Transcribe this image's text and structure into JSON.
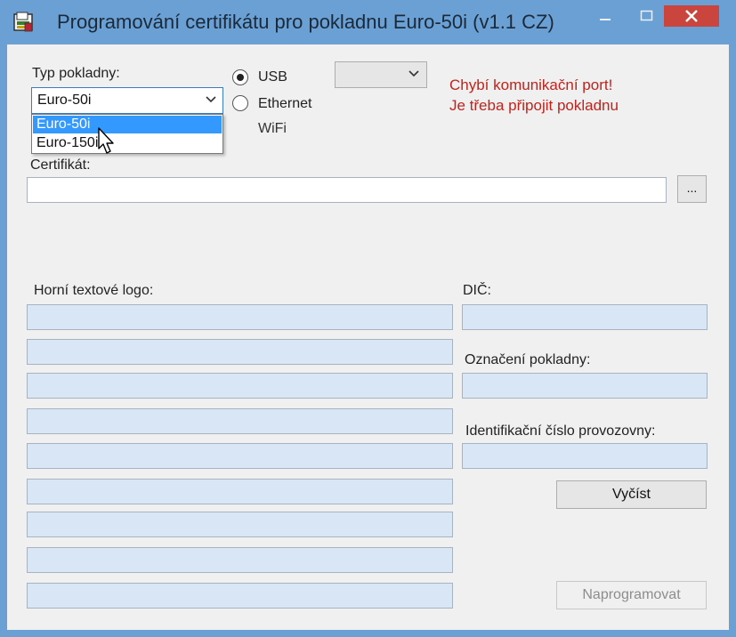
{
  "window": {
    "title": "Programování certifikátu pro pokladnu Euro-50i (v1.1 CZ)",
    "controls": {
      "minimize": "—",
      "maximize": "☐",
      "close": "✕"
    }
  },
  "cash_register_type": {
    "label": "Typ pokladny:",
    "selected": "Euro-50i",
    "options": [
      "Euro-50i",
      "Euro-150i"
    ]
  },
  "connection": {
    "options": [
      {
        "label": "USB",
        "checked": true
      },
      {
        "label": "Ethernet",
        "checked": false
      },
      {
        "label": "WiFi",
        "checked": false
      }
    ]
  },
  "error_message": {
    "line1": "Chybí komunikační port!",
    "line2": "Je třeba připojit pokladnu"
  },
  "certificate": {
    "label": "Certifikát:",
    "value": "",
    "browse_label": "..."
  },
  "upper_logo": {
    "label": "Horní textové logo:",
    "lines": [
      "",
      "",
      "",
      "",
      "",
      "",
      "",
      "",
      ""
    ]
  },
  "dic": {
    "label": "DIČ:",
    "value": ""
  },
  "register_id": {
    "label": "Označení pokladny:",
    "value": ""
  },
  "premises_id": {
    "label": "Identifikační číslo provozovny:",
    "value": ""
  },
  "buttons": {
    "read": "Vyčíst",
    "program": "Naprogramovat"
  },
  "colors": {
    "titlebar": "#6ba0d5",
    "close_button": "#c9453d",
    "error_text": "#c0231c",
    "selection": "#3399ff",
    "field_fill": "#d8e6f5"
  }
}
